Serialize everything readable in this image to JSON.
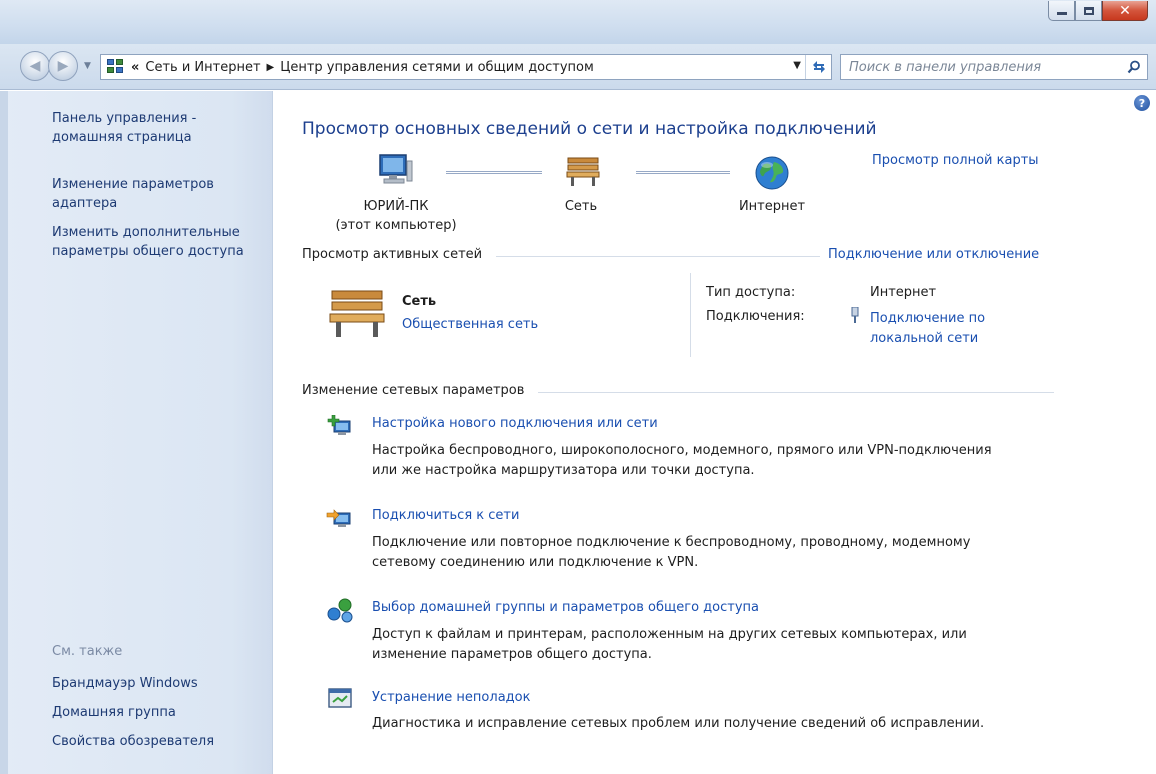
{
  "nav": {
    "breadcrumb": [
      "Сеть и Интернет",
      "Центр управления сетями и общим доступом"
    ],
    "search_placeholder": "Поиск в панели управления"
  },
  "sidebar": {
    "home_link": "Панель управления -\nдомашняя страница",
    "adapter_link": "Изменение параметров\nадаптера",
    "sharing_link": "Изменить дополнительные\nпараметры общего доступа",
    "see_also_label": "См. также",
    "see_also_links": [
      "Брандмауэр Windows",
      "Домашняя группа",
      "Свойства обозревателя"
    ]
  },
  "main": {
    "title": "Просмотр основных сведений о сети и настройка подключений",
    "full_map_link": "Просмотр полной карты",
    "map": {
      "computer_name": "ЮРИЙ-ПК",
      "computer_sub": "(этот компьютер)",
      "network_name": "Сеть",
      "internet_name": "Интернет"
    },
    "active_networks": {
      "heading": "Просмотр активных сетей",
      "connect_link": "Подключение или отключение",
      "network_name": "Сеть",
      "network_type": "Общественная сеть",
      "access_label": "Тип доступа:",
      "access_value": "Интернет",
      "connections_label": "Подключения:",
      "connection_link": "Подключение по\nлокальной сети"
    },
    "change_settings": {
      "heading": "Изменение сетевых параметров",
      "tasks": [
        {
          "title": "Настройка нового подключения или сети",
          "desc": "Настройка беспроводного, широкополосного, модемного, прямого или VPN-подключения\nили же настройка маршрутизатора или точки доступа."
        },
        {
          "title": "Подключиться к сети",
          "desc": "Подключение или повторное подключение к беспроводному, проводному, модемному\nсетевому соединению или подключение к VPN."
        },
        {
          "title": "Выбор домашней группы и параметров общего доступа",
          "desc": "Доступ к файлам и принтерам, расположенным на других сетевых компьютерах, или\nизменение параметров общего доступа."
        },
        {
          "title": "Устранение неполадок",
          "desc": "Диагностика и исправление сетевых проблем или получение сведений об исправлении."
        }
      ]
    }
  }
}
